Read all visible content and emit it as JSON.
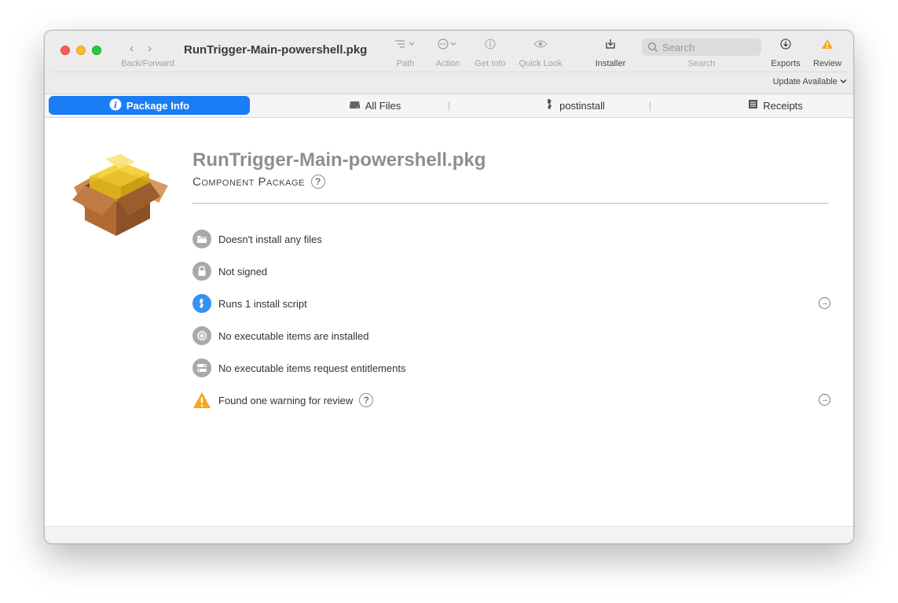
{
  "toolbar": {
    "nav_label": "Back/Forward",
    "window_title": "RunTrigger-Main-powershell.pkg",
    "path_label": "Path",
    "action_label": "Action",
    "get_info_label": "Get Info",
    "quick_look_label": "Quick Look",
    "installer_label": "Installer",
    "search_placeholder": "Search",
    "search_label": "Search",
    "exports_label": "Exports",
    "review_label": "Review",
    "update_text": "Update Available"
  },
  "tabs": [
    {
      "label": "Package Info",
      "icon": "info-icon",
      "active": true
    },
    {
      "label": "All Files",
      "icon": "drive-icon",
      "active": false
    },
    {
      "label": "postinstall",
      "icon": "script-icon",
      "active": false
    },
    {
      "label": "Receipts",
      "icon": "receipt-icon",
      "active": false
    }
  ],
  "package": {
    "title": "RunTrigger-Main-powershell.pkg",
    "subtitle": "Component Package"
  },
  "info_rows": [
    {
      "text": "Doesn't install any files",
      "icon": "folder-icon"
    },
    {
      "text": "Not signed",
      "icon": "lock-icon"
    },
    {
      "text": "Runs 1 install script",
      "icon": "script-icon"
    },
    {
      "text": "No executable items are installed",
      "icon": "chip-icon"
    },
    {
      "text": "No executable items request entitlements",
      "icon": "entitlements-icon"
    },
    {
      "text": "Found one warning for review",
      "icon": "warning-icon"
    }
  ],
  "colors": {
    "accent": "#1a7df5",
    "warning": "#f5a623",
    "title_gray": "#8e8e8e"
  }
}
